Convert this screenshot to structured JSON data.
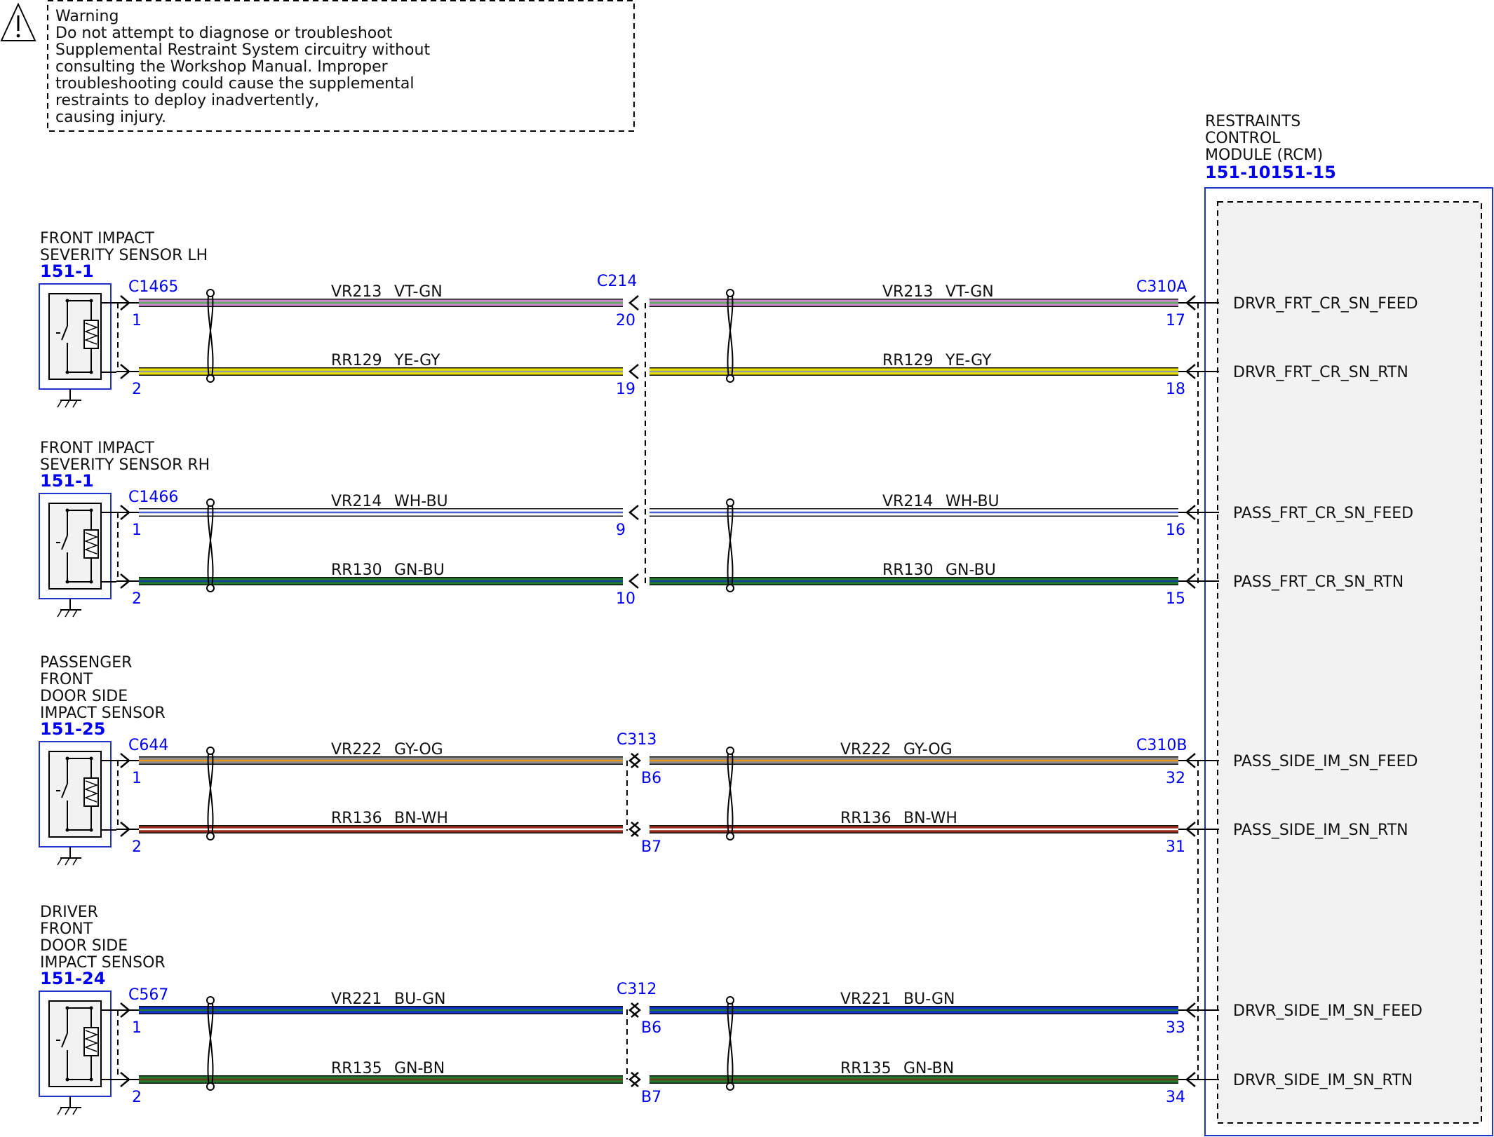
{
  "warning": {
    "icon": "warning-triangle-icon",
    "lines": [
      "Warning",
      "Do not attempt to diagnose or troubleshoot",
      "Supplemental Restraint System circuitry without",
      "consulting the Workshop Manual. Improper",
      "troubleshooting could cause the supplemental",
      "restraints to deploy inadvertently,",
      "causing injury."
    ]
  },
  "module": {
    "name_lines": [
      "RESTRAINTS",
      "CONTROL",
      "MODULE (RCM)"
    ],
    "ref": "151-10151-15"
  },
  "sensors": [
    {
      "name_lines": [
        "FRONT IMPACT",
        "SEVERITY SENSOR LH"
      ],
      "ref": "151-1",
      "connector": "C1465",
      "inline": "C214",
      "rcm_connector": "C310A"
    },
    {
      "name_lines": [
        "FRONT IMPACT",
        "SEVERITY SENSOR RH"
      ],
      "ref": "151-1",
      "connector": "C1466",
      "inline": "",
      "rcm_connector": ""
    },
    {
      "name_lines": [
        "PASSENGER",
        "FRONT",
        "DOOR SIDE",
        "IMPACT SENSOR"
      ],
      "ref": "151-25",
      "connector": "C644",
      "inline": "C313",
      "rcm_connector": "C310B"
    },
    {
      "name_lines": [
        "DRIVER",
        "FRONT",
        "DOOR SIDE",
        "IMPACT SENSOR"
      ],
      "ref": "151-24",
      "connector": "C567",
      "inline": "C312",
      "rcm_connector": ""
    }
  ],
  "circuits": [
    {
      "circuit": "VR213",
      "color": "VT-GN",
      "base": "#c98bc9",
      "stripe": "#5fae5f",
      "sensor_pin": "1",
      "inline_in": "20",
      "inline_out": "",
      "rcm_pin": "17",
      "signal": "DRVR_FRT_CR_SN_FEED"
    },
    {
      "circuit": "RR129",
      "color": "YE-GY",
      "base": "#e8e000",
      "stripe": "#9a9a9a",
      "sensor_pin": "2",
      "inline_in": "19",
      "inline_out": "",
      "rcm_pin": "18",
      "signal": "DRVR_FRT_CR_SN_RTN"
    },
    {
      "circuit": "VR214",
      "color": "WH-BU",
      "base": "#ffffff",
      "stripe": "#4a5fd0",
      "sensor_pin": "1",
      "inline_in": "9",
      "inline_out": "",
      "rcm_pin": "16",
      "signal": "PASS_FRT_CR_SN_FEED"
    },
    {
      "circuit": "RR130",
      "color": "GN-BU",
      "base": "#1f7a2a",
      "stripe": "#1a3fa0",
      "sensor_pin": "2",
      "inline_in": "10",
      "inline_out": "",
      "rcm_pin": "15",
      "signal": "PASS_FRT_CR_SN_RTN"
    },
    {
      "circuit": "VR222",
      "color": "GY-OG",
      "base": "#8f8f8f",
      "stripe": "#e8921a",
      "sensor_pin": "1",
      "inline_in": "",
      "inline_out": "B6",
      "rcm_pin": "32",
      "signal": "PASS_SIDE_IM_SN_FEED"
    },
    {
      "circuit": "RR136",
      "color": "BN-WH",
      "base": "#9a2a1a",
      "stripe": "#ffffff",
      "sensor_pin": "2",
      "inline_in": "",
      "inline_out": "B7",
      "rcm_pin": "31",
      "signal": "PASS_SIDE_IM_SN_RTN"
    },
    {
      "circuit": "VR221",
      "color": "BU-GN",
      "base": "#1030d0",
      "stripe": "#1f7a2a",
      "sensor_pin": "1",
      "inline_in": "",
      "inline_out": "B6",
      "rcm_pin": "33",
      "signal": "DRVR_SIDE_IM_SN_FEED"
    },
    {
      "circuit": "RR135",
      "color": "GN-BN",
      "base": "#1f7a2a",
      "stripe": "#6b3a1a",
      "sensor_pin": "2",
      "inline_in": "",
      "inline_out": "B7",
      "rcm_pin": "34",
      "signal": "DRVR_SIDE_IM_SN_RTN"
    }
  ]
}
